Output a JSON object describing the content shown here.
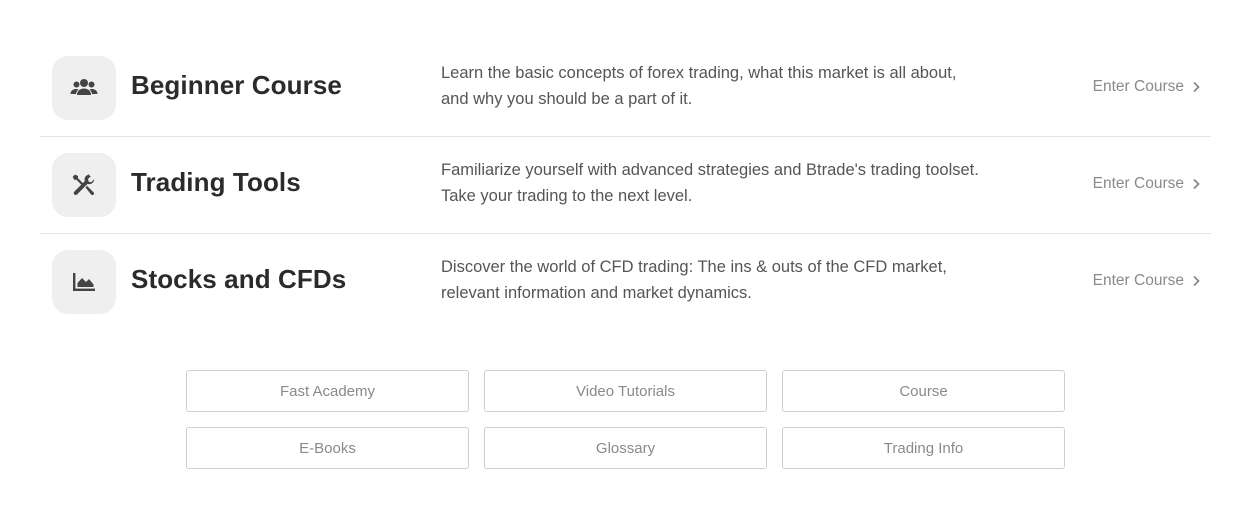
{
  "courses": [
    {
      "icon": "users-icon",
      "title": "Beginner Course",
      "description": "Learn the basic concepts of forex trading, what this market is all about, and why you should be a part of it.",
      "link_label": "Enter Course"
    },
    {
      "icon": "tools-icon",
      "title": "Trading Tools",
      "description": "Familiarize yourself with advanced strategies and Btrade's trading toolset. Take your trading to the next level.",
      "link_label": "Enter Course"
    },
    {
      "icon": "area-chart-icon",
      "title": "Stocks and CFDs",
      "description": "Discover the world of CFD trading: The ins & outs of the CFD market, relevant information and market dynamics.",
      "link_label": "Enter Course"
    }
  ],
  "nav_buttons": [
    "Fast Academy",
    "Video Tutorials",
    "Course",
    "E-Books",
    "Glossary",
    "Trading Info"
  ],
  "colors": {
    "icon_bg": "#efefef",
    "icon_fg": "#444444",
    "title": "#2b2b2b",
    "muted": "#8a8a8a",
    "divider": "#e4e4e4"
  }
}
